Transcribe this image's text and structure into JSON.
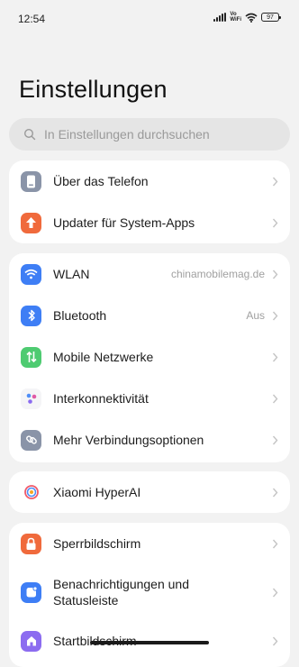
{
  "status_bar": {
    "time": "12:54",
    "network_label_top": "Vo",
    "network_label_bottom": "WiFi",
    "battery": "97"
  },
  "header": {
    "title": "Einstellungen"
  },
  "search": {
    "placeholder": "In Einstellungen durchsuchen"
  },
  "colors": {
    "background": "#f2f2f2",
    "card": "#ffffff",
    "phone_icon": "#8a94a8",
    "updater_icon": "#f06a3c",
    "wlan_icon": "#3e7ef5",
    "bluetooth_icon": "#3e7ef5",
    "mobile_icon": "#4ecb71",
    "interconnect_icon": "#f5f5f7",
    "more_icon": "#8a94a8",
    "lock_icon": "#f06a3c",
    "notif_icon": "#3e7ef5",
    "home_icon": "#8c6cf0"
  },
  "groups": [
    {
      "items": [
        {
          "label": "Über das Telefon",
          "icon": "phone-icon"
        },
        {
          "label": "Updater für System-Apps",
          "icon": "update-arrow-icon"
        }
      ]
    },
    {
      "items": [
        {
          "label": "WLAN",
          "value": "chinamobilemag.de",
          "icon": "wifi-icon"
        },
        {
          "label": "Bluetooth",
          "value": "Aus",
          "icon": "bluetooth-icon"
        },
        {
          "label": "Mobile Netzwerke",
          "icon": "mobile-network-icon"
        },
        {
          "label": "Interkonnektivität",
          "icon": "interconnectivity-icon"
        },
        {
          "label": "Mehr Verbindungsoptionen",
          "icon": "link-icon"
        }
      ]
    },
    {
      "items": [
        {
          "label": "Xiaomi HyperAI",
          "icon": "hyperai-icon"
        }
      ]
    },
    {
      "items": [
        {
          "label": "Sperrbildschirm",
          "icon": "lock-icon"
        },
        {
          "label": "Benachrichtigungen und Statusleiste",
          "icon": "notification-icon"
        },
        {
          "label": "Startbildschirm",
          "icon": "home-icon"
        }
      ]
    }
  ]
}
